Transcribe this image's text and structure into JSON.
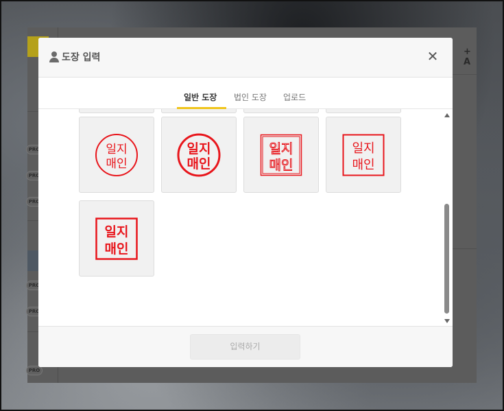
{
  "modal": {
    "title": "도장 입력",
    "close_icon": "close-icon",
    "tabs": [
      {
        "label": "일반 도장",
        "active": true
      },
      {
        "label": "법인 도장",
        "active": false
      },
      {
        "label": "업로드",
        "active": false
      }
    ],
    "submit_label": "입력하기"
  },
  "background_app": {
    "add_label": "+ A",
    "pro_badges": [
      "PRO",
      "PRO",
      "PRO",
      "PRO",
      "PRO",
      "PRO",
      "PRO",
      "PRO"
    ]
  },
  "stamps": [
    {
      "id": "stamp-1",
      "style": "circle-thin",
      "line1": "일지",
      "line2": "매인"
    },
    {
      "id": "stamp-2",
      "style": "circle-bold",
      "line1": "일지",
      "line2": "매인"
    },
    {
      "id": "stamp-3",
      "style": "square-hollow",
      "line1": "일지",
      "line2": "매인"
    },
    {
      "id": "stamp-4",
      "style": "square-thin",
      "line1": "일지",
      "line2": "매인"
    },
    {
      "id": "stamp-5",
      "style": "square-bold",
      "line1": "일지",
      "line2": "매인"
    }
  ],
  "colors": {
    "accent": "#f0c419",
    "stamp_red": "#e8151b"
  }
}
